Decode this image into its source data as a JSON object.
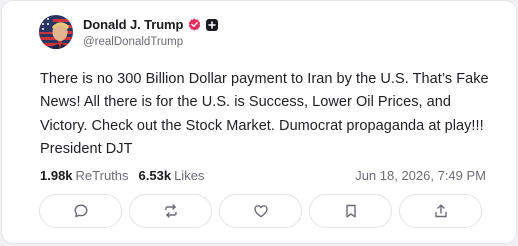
{
  "post": {
    "author": {
      "display_name": "Donald J. Trump",
      "handle": "@realDonaldTrump"
    },
    "text": "There is no 300 Billion Dollar payment to Iran by the U.S. That’s Fake News! All there is for the U.S. is Success, Lower Oil Prices, and Victory. Check out the Stock Market. Dumocrat propaganda at play!!! President DJT",
    "stats": {
      "retruths_count": "1.98k",
      "retruths_label": "ReTruths",
      "likes_count": "6.53k",
      "likes_label": "Likes"
    },
    "timestamp": "Jun 18, 2026, 7:49 PM"
  },
  "icons": {
    "verified": "verified-badge-icon",
    "plus": "plus-icon",
    "reply": "reply-icon",
    "retruth": "retruth-icon",
    "like": "heart-icon",
    "bookmark": "bookmark-icon",
    "share": "share-icon"
  },
  "colors": {
    "verified_badge": "#e0335f",
    "text_primary": "#1f1f24",
    "text_secondary": "#6d6d75",
    "icon": "#6b6b74"
  }
}
